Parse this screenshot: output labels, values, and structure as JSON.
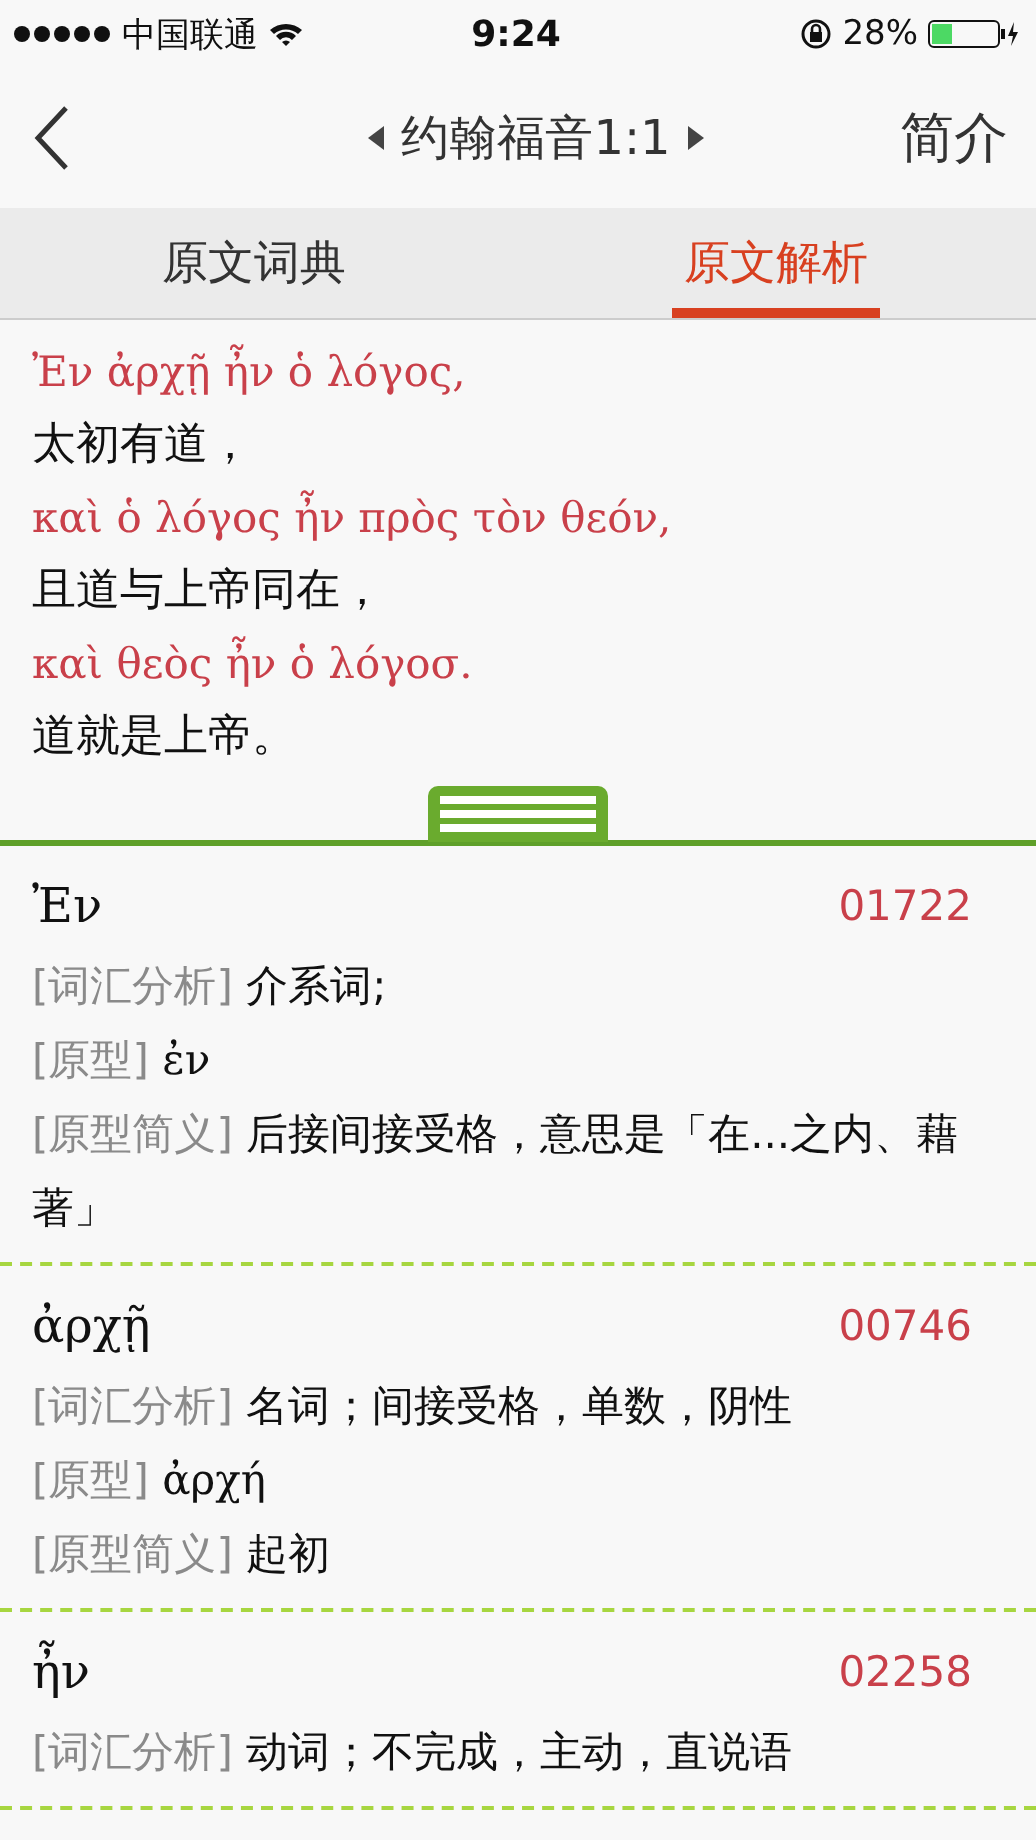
{
  "status_bar": {
    "carrier": "中国联通",
    "time": "9:24",
    "battery": "28%"
  },
  "nav": {
    "title": "约翰福音1:1",
    "right_button": "简介"
  },
  "tabs": [
    {
      "label": "原文词典",
      "selected": false
    },
    {
      "label": "原文解析",
      "selected": true
    }
  ],
  "verse": [
    {
      "kind": "greek",
      "text": "Ἐν ἀρχῇ ἦν ὁ λόγος,"
    },
    {
      "kind": "chinese",
      "text": "太初有道，"
    },
    {
      "kind": "greek",
      "text": "καὶ ὁ λόγος ἦν πρὸς τὸν θεόν,"
    },
    {
      "kind": "chinese",
      "text": "且道与上帝同在，"
    },
    {
      "kind": "greek",
      "text": "καὶ θεὸς ἦν ὁ λόγοσ."
    },
    {
      "kind": "chinese",
      "text": "道就是上帝。"
    }
  ],
  "entries": [
    {
      "word": "Ἐν",
      "number": "01722",
      "fields": [
        {
          "label": "[词汇分析]",
          "value": "介系词;",
          "kind": "text"
        },
        {
          "label": "[原型]",
          "value": "ἐν",
          "kind": "greek"
        },
        {
          "label": "[原型简义]",
          "value": "后接间接受格，意思是「在...之内、藉著」",
          "kind": "text"
        }
      ]
    },
    {
      "word": "ἀρχῇ",
      "number": "00746",
      "fields": [
        {
          "label": "[词汇分析]",
          "value": "名词；间接受格，单数，阴性",
          "kind": "text"
        },
        {
          "label": "[原型]",
          "value": "ἀρχή",
          "kind": "greek"
        },
        {
          "label": "[原型简义]",
          "value": "起初",
          "kind": "text"
        }
      ]
    },
    {
      "word": "ἦν",
      "number": "02258",
      "fields": [
        {
          "label": "[词汇分析]",
          "value": "动词；不完成，主动，直说语",
          "kind": "text"
        }
      ]
    }
  ]
}
